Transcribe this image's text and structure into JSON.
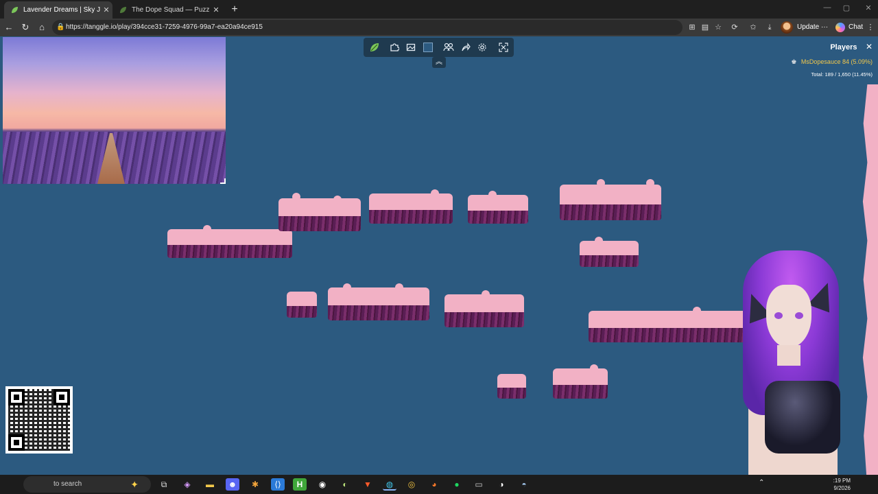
{
  "browser": {
    "tabs": [
      {
        "title": "Lavender Dreams | Sky Jigsaw",
        "active": true
      },
      {
        "title": "The Dope Squad — Puzzles",
        "active": false
      }
    ],
    "new_tab": "+",
    "window_controls": [
      "—",
      "▢",
      "✕"
    ],
    "url": "https://tanggle.io/play/394cce31-7259-4976-99a7-ea20a94ce915",
    "update_label": "Update",
    "more_label": "···",
    "chat_label": "Chat"
  },
  "game": {
    "players_title": "Players",
    "player": {
      "name": "MsDopesauce",
      "score": "84 (5.09%)"
    },
    "total": "Total: 189 / 1,650 (11.45%)",
    "accent_color": "#2c5a80",
    "piece_colors": {
      "sky": "#f2b1c5",
      "lavender": "#5a1e54"
    }
  },
  "taskbar": {
    "search_placeholder": "Type here to search",
    "search_visible": "to search",
    "clock_time": ":19 PM",
    "clock_date": "9/2026"
  },
  "icons": {
    "toolbar": [
      "tanggle-logo-icon",
      "puzzle-piece-icon",
      "image-icon",
      "color-swatch-icon",
      "players-icon",
      "share-icon",
      "settings-icon",
      "fullscreen-icon"
    ],
    "taskbar": [
      "task-view-icon",
      "copilot-icon",
      "file-explorer-icon",
      "discord-icon",
      "app-icon",
      "vscode-icon",
      "hotspot-icon",
      "obs-icon",
      "app-icon",
      "brave-icon",
      "edge-icon",
      "chrome-icon",
      "firefox-icon",
      "spotify-icon",
      "app-icon",
      "app-icon",
      "steam-icon"
    ]
  }
}
